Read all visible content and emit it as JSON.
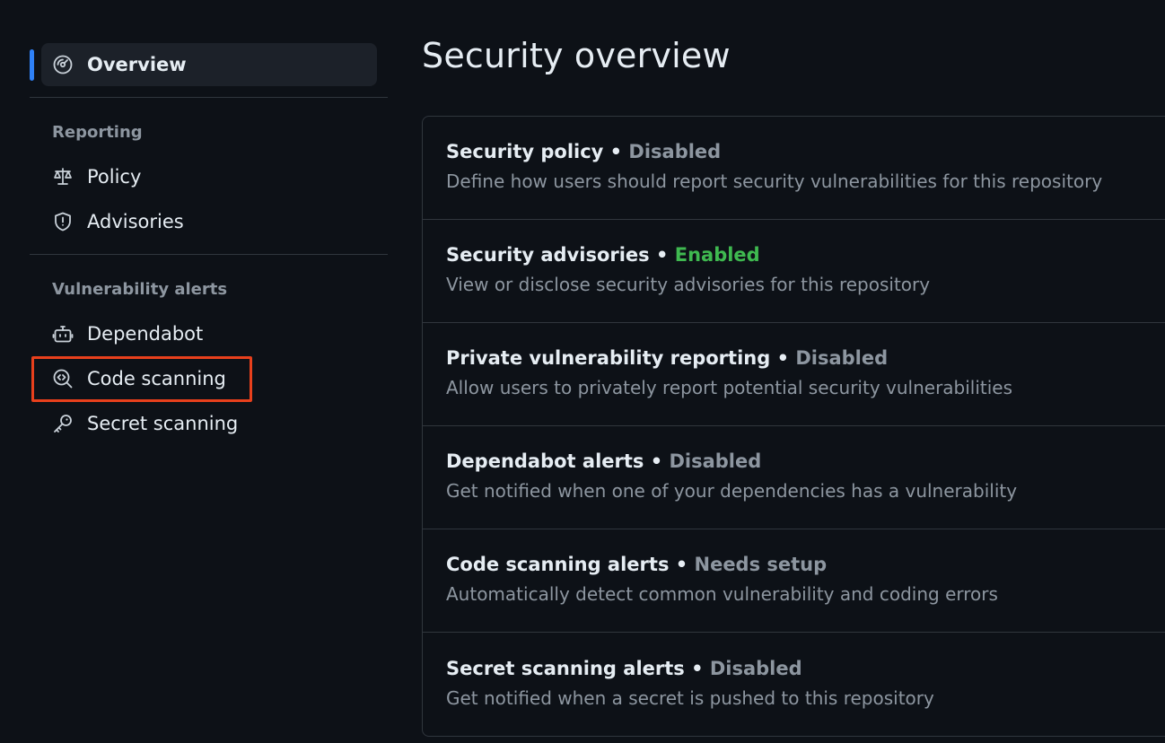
{
  "sidebar": {
    "overview": {
      "label": "Overview",
      "icon": "meter-icon"
    },
    "groups": [
      {
        "label": "Reporting",
        "items": [
          {
            "label": "Policy",
            "icon": "law-icon"
          },
          {
            "label": "Advisories",
            "icon": "shield-icon"
          }
        ]
      },
      {
        "label": "Vulnerability alerts",
        "items": [
          {
            "label": "Dependabot",
            "icon": "dependabot-icon"
          },
          {
            "label": "Code scanning",
            "icon": "codescan-icon"
          },
          {
            "label": "Secret scanning",
            "icon": "key-icon"
          }
        ]
      }
    ],
    "highlight_color": "#e8401c",
    "active_color": "#2f81f7"
  },
  "main": {
    "title": "Security overview",
    "rows": [
      {
        "title": "Security policy",
        "separator": " • ",
        "status": "Disabled",
        "desc": "Define how users should report security vulnerabilities for this repository"
      },
      {
        "title": "Security advisories",
        "separator": " • ",
        "status": "Enabled",
        "desc": "View or disclose security advisories for this repository"
      },
      {
        "title": "Private vulnerability reporting",
        "separator": " • ",
        "status": "Disabled",
        "desc": "Allow users to privately report potential security vulnerabilities"
      },
      {
        "title": "Dependabot alerts",
        "separator": " • ",
        "status": "Disabled",
        "desc": "Get notified when one of your dependencies has a vulnerability"
      },
      {
        "title": "Code scanning alerts",
        "separator": " • ",
        "status": "Needs setup",
        "desc": "Automatically detect common vulnerability and coding errors"
      },
      {
        "title": "Secret scanning alerts",
        "separator": " • ",
        "status": "Disabled",
        "desc": "Get notified when a secret is pushed to this repository"
      }
    ],
    "colors": {
      "enabled": "#3fb950",
      "muted": "#8d96a0"
    }
  }
}
